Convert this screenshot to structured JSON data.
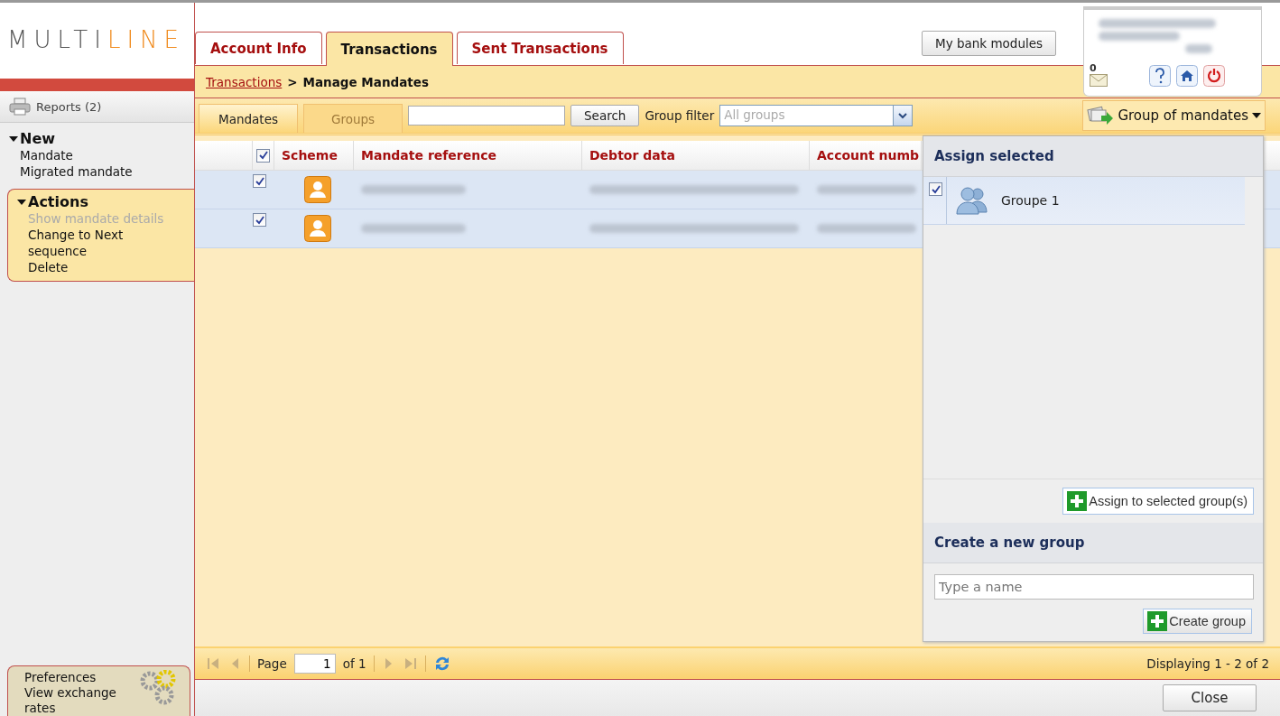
{
  "logo": {
    "plain": "MULTI",
    "accent": "LINE"
  },
  "tabs": [
    {
      "label": "Account Info",
      "selected": false
    },
    {
      "label": "Transactions",
      "selected": true
    },
    {
      "label": "Sent Transactions",
      "selected": false
    }
  ],
  "bank_modules_button": "My bank modules",
  "user_box": {
    "mail_count": "0"
  },
  "breadcrumb": {
    "link": "Transactions",
    "separator": ">",
    "current": "Manage Mandates"
  },
  "sidebar": {
    "reports": "Reports (2)",
    "sections": [
      {
        "title": "New",
        "highlighted": false,
        "items": [
          {
            "label": "Mandate",
            "disabled": false
          },
          {
            "label": "Migrated mandate",
            "disabled": false
          }
        ]
      },
      {
        "title": "Actions",
        "highlighted": true,
        "items": [
          {
            "label": "Show mandate details",
            "disabled": true
          },
          {
            "label": "Change to Next sequence",
            "disabled": false
          },
          {
            "label": "Delete",
            "disabled": false
          }
        ]
      }
    ],
    "footer_links": [
      "Preferences",
      "View exchange rates"
    ]
  },
  "subtabs": [
    {
      "label": "Mandates",
      "selected": true
    },
    {
      "label": "Groups",
      "selected": false
    }
  ],
  "search_button": "Search",
  "group_filter": {
    "label": "Group filter",
    "placeholder": "All groups"
  },
  "group_menu": {
    "label": "Group of mandates",
    "expanded": true
  },
  "table": {
    "header_checked": true,
    "columns": [
      "Scheme",
      "Mandate reference",
      "Debtor data",
      "Account numb"
    ],
    "rows": [
      {
        "checked": true,
        "selected": true
      },
      {
        "checked": true,
        "selected": true
      }
    ]
  },
  "pager": {
    "page_label": "Page",
    "page": "1",
    "of": "of 1",
    "display": "Displaying 1 - 2 of 2"
  },
  "close_button": "Close",
  "group_panel": {
    "assign_title": "Assign selected",
    "groups": [
      {
        "name": "Groupe 1",
        "checked": true
      }
    ],
    "assign_button": "Assign to selected group(s)",
    "create_title": "Create a new group",
    "name_placeholder": "Type a name",
    "create_button": "Create group"
  }
}
